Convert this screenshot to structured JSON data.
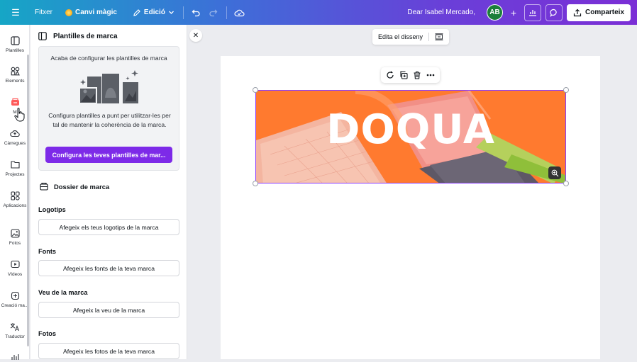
{
  "topbar": {
    "file_label": "Fitxer",
    "magic_label": "Canvi màgic",
    "edit_label": "Edició",
    "greeting": "Dear Isabel Mercado,",
    "avatar_initials": "AB",
    "share_label": "Comparteix"
  },
  "rail": {
    "items": [
      {
        "label": "Plantilles",
        "icon": "template-icon"
      },
      {
        "label": "Elements",
        "icon": "elements-icon"
      },
      {
        "label": "M",
        "icon": "brand-icon"
      },
      {
        "label": "Càrregues",
        "icon": "upload-cloud-icon"
      },
      {
        "label": "Projectes",
        "icon": "folder-icon"
      },
      {
        "label": "Aplicacions",
        "icon": "apps-icon"
      },
      {
        "label": "Fotos",
        "icon": "photo-icon"
      },
      {
        "label": "Vídeos",
        "icon": "video-icon"
      },
      {
        "label": "Creació ma...",
        "icon": "magic-create-icon"
      },
      {
        "label": "Traductor",
        "icon": "translate-icon"
      }
    ]
  },
  "panel": {
    "title": "Plantilles de marca",
    "card": {
      "title": "Acaba de configurar les plantilles de marca",
      "body": "Configura plantilles a punt per utilitzar-les per tal de mantenir la coherència de la marca.",
      "cta": "Configura les teves plantilles de mar..."
    },
    "kit_title": "Dossier de marca",
    "sections": [
      {
        "title": "Logotips",
        "button": "Afegeix els teus logotips de la marca"
      },
      {
        "title": "Fonts",
        "button": "Afegeix les fonts de la teva marca"
      },
      {
        "title": "Veu de la marca",
        "button": "Afegeix la veu de la marca"
      },
      {
        "title": "Fotos",
        "button": "Afegeix les fotos de la teva marca"
      }
    ]
  },
  "workspace": {
    "edit_design_label": "Edita el disseny",
    "banner_text": "DOQUA"
  },
  "colors": {
    "accent": "#7d2ae8",
    "banner_orange": "#ff7a2f",
    "avatar_green": "#1b7f3b"
  }
}
